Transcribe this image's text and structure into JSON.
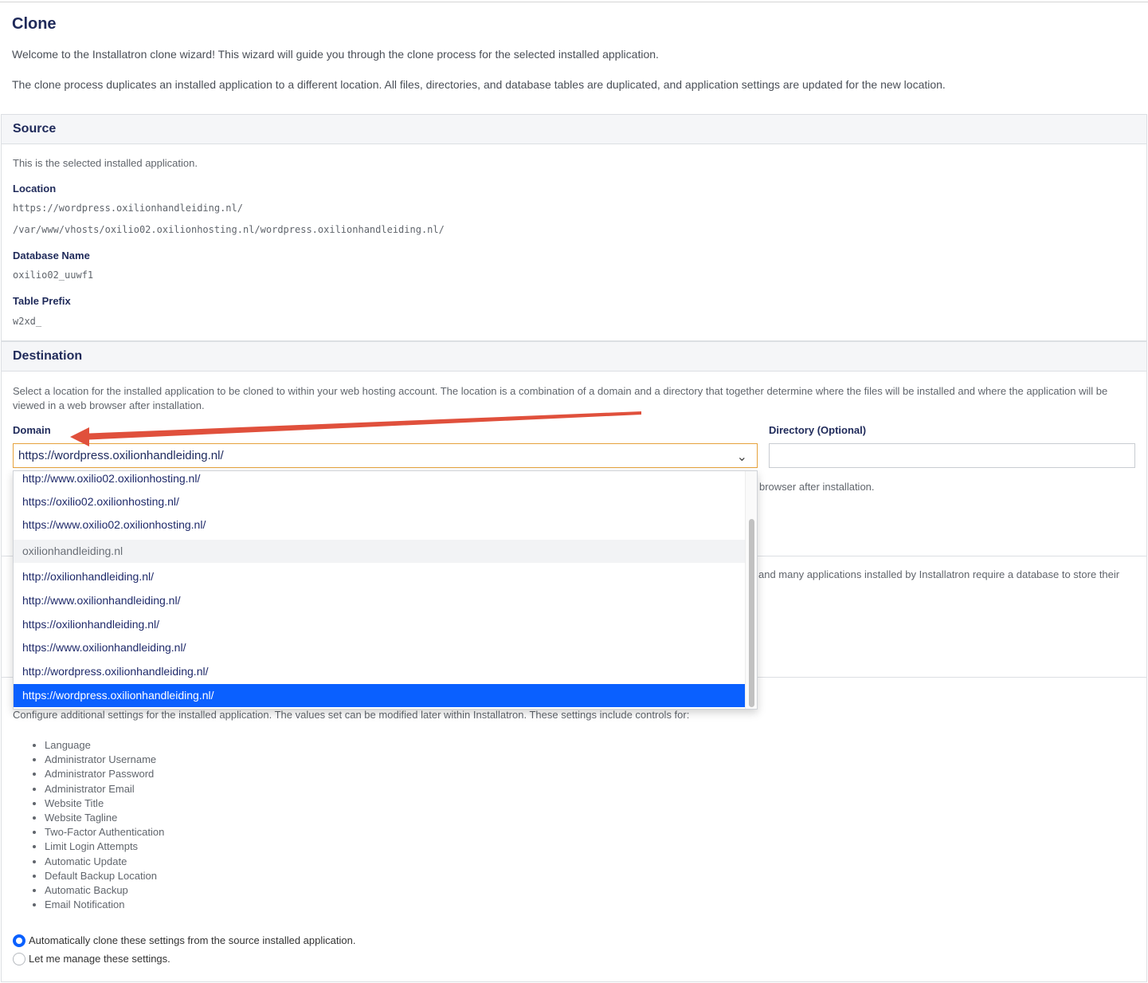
{
  "page": {
    "title": "Clone",
    "intro1": "Welcome to the Installatron clone wizard! This wizard will guide you through the clone process for the selected installed application.",
    "intro2": "The clone process duplicates an installed application to a different location. All files, directories, and database tables are duplicated, and application settings are updated for the new location."
  },
  "source": {
    "heading": "Source",
    "desc": "This is the selected installed application.",
    "location_label": "Location",
    "location_url": "https://wordpress.oxilionhandleiding.nl/",
    "location_path": "/var/www/vhosts/oxilio02.oxilionhosting.nl/wordpress.oxilionhandleiding.nl/",
    "db_label": "Database Name",
    "db_value": "oxilio02_uuwf1",
    "prefix_label": "Table Prefix",
    "prefix_value": "w2xd_"
  },
  "destination": {
    "heading": "Destination",
    "desc": "Select a location for the installed application to be cloned to within your web hosting account. The location is a combination of a domain and a directory that together determine where the files will be installed and where the application will be viewed in a web browser after installation.",
    "domain_label": "Domain",
    "domain_selected": "https://wordpress.oxilionhandleiding.nl/",
    "directory_label": "Directory (Optional)",
    "directory_value": "",
    "partial_hint": "browser after installation.",
    "domain_options": [
      {
        "label": "http://www.oxilio02.oxilionhosting.nl/",
        "type": "option"
      },
      {
        "label": "https://oxilio02.oxilionhosting.nl/",
        "type": "option"
      },
      {
        "label": "https://www.oxilio02.oxilionhosting.nl/",
        "type": "option"
      },
      {
        "label": "oxilionhandleiding.nl",
        "type": "group"
      },
      {
        "label": "http://oxilionhandleiding.nl/",
        "type": "option"
      },
      {
        "label": "http://www.oxilionhandleiding.nl/",
        "type": "option"
      },
      {
        "label": "https://oxilionhandleiding.nl/",
        "type": "option"
      },
      {
        "label": "https://www.oxilionhandleiding.nl/",
        "type": "option"
      },
      {
        "label": "http://wordpress.oxilionhandleiding.nl/",
        "type": "option"
      },
      {
        "label": "https://wordpress.oxilionhandleiding.nl/",
        "type": "selected"
      }
    ]
  },
  "database": {
    "partial_desc": "and many applications installed by Installatron require a database to store their"
  },
  "settings": {
    "desc": "Configure additional settings for the installed application. The values set can be modified later within Installatron. These settings include controls for:",
    "items": [
      "Language",
      "Administrator Username",
      "Administrator Password",
      "Administrator Email",
      "Website Title",
      "Website Tagline",
      "Two-Factor Authentication",
      "Limit Login Attempts",
      "Automatic Update",
      "Default Backup Location",
      "Automatic Backup",
      "Email Notification"
    ],
    "radio_auto": "Automatically clone these settings from the source installed application.",
    "radio_manual": "Let me manage these settings."
  },
  "colors": {
    "accent": "#0a60ff",
    "heading": "#1f2a5a",
    "annotation_arrow": "#e0503c"
  }
}
